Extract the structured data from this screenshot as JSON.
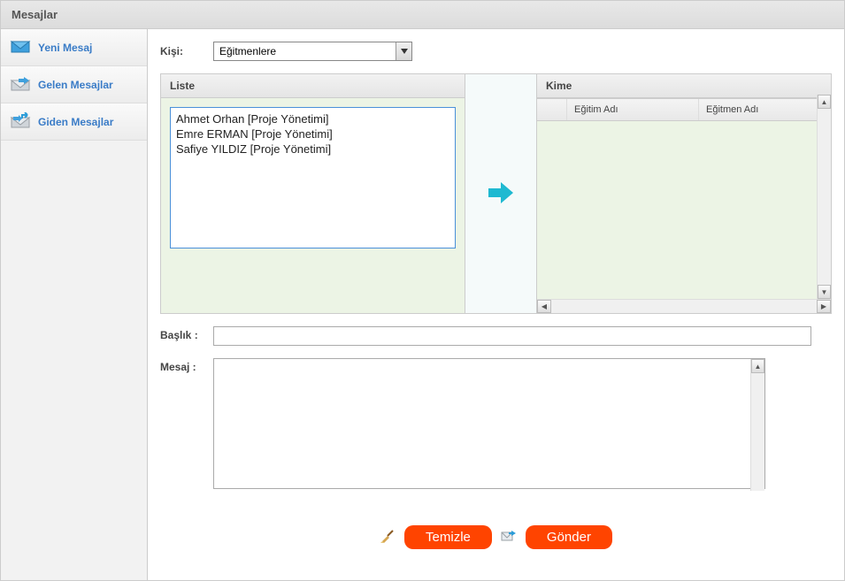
{
  "header": {
    "title": "Mesajlar"
  },
  "sidebar": {
    "items": [
      {
        "label": "Yeni Mesaj"
      },
      {
        "label": "Gelen Mesajlar"
      },
      {
        "label": "Giden Mesajlar"
      }
    ]
  },
  "form": {
    "kisi_label": "Kişi:",
    "kisi_value": "Eğitmenlere",
    "liste_header": "Liste",
    "kime_header": "Kime",
    "liste_items": [
      "Ahmet Orhan [Proje Yönetimi]",
      "Emre ERMAN [Proje Yönetimi]",
      "Safiye YILDIZ [Proje Yönetimi]"
    ],
    "grid_col_spacer": "",
    "grid_col1": "Eğitim Adı",
    "grid_col2": "Eğitmen Adı",
    "baslik_label": "Başlık :",
    "baslik_value": "",
    "mesaj_label": "Mesaj :",
    "mesaj_value": ""
  },
  "buttons": {
    "clear": "Temizle",
    "send": "Gönder"
  }
}
